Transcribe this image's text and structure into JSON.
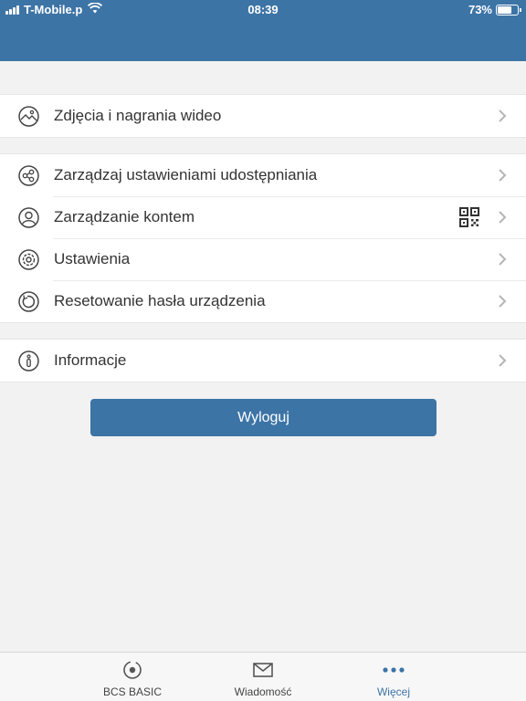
{
  "status_bar": {
    "carrier": "T-Mobile.p",
    "time": "08:39",
    "battery": "73%",
    "battery_level": 0.73
  },
  "menu_groups": [
    [
      {
        "label": "Zdjęcia i nagrania wideo",
        "icon": "photo-icon"
      }
    ],
    [
      {
        "label": "Zarządzaj ustawieniami udostępniania",
        "icon": "share-icon"
      },
      {
        "label": "Zarządzanie kontem",
        "icon": "user-icon",
        "extra_icon": "qr-code-icon"
      },
      {
        "label": "Ustawienia",
        "icon": "settings-icon"
      },
      {
        "label": "Resetowanie hasła urządzenia",
        "icon": "reset-icon"
      }
    ],
    [
      {
        "label": "Informacje",
        "icon": "info-icon"
      }
    ]
  ],
  "logout_label": "Wyloguj",
  "tabs": [
    {
      "label": "BCS BASIC",
      "icon": "camera-icon",
      "active": false
    },
    {
      "label": "Wiadomość",
      "icon": "mail-icon",
      "active": false
    },
    {
      "label": "Więcej",
      "icon": "more-icon",
      "active": true
    }
  ],
  "colors": {
    "accent": "#3d74a6",
    "background": "#f2f2f2",
    "text": "#333333"
  }
}
